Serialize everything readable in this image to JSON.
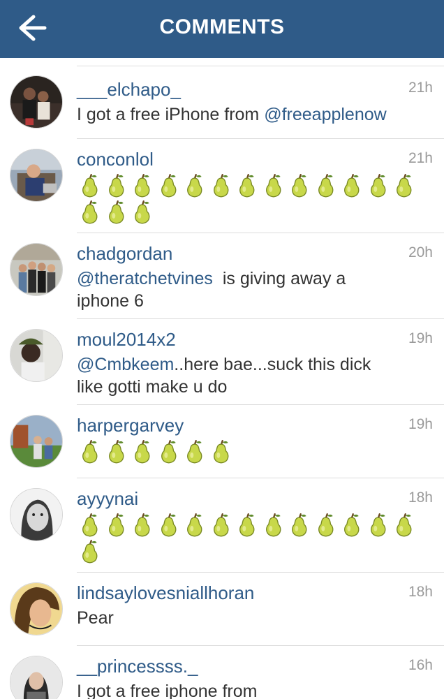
{
  "header": {
    "title": "COMMENTS"
  },
  "comments": [
    {
      "username": "___elchapo_",
      "time": "21h",
      "text": "I got a free iPhone from ",
      "mention": "@freeapplenow"
    },
    {
      "username": "conconlol",
      "time": "21h",
      "pear_count": 16
    },
    {
      "username": "chadgordan",
      "time": "20h",
      "mention": "@theratchetvines",
      "text": "  is giving away a",
      "text2": "iphone 6"
    },
    {
      "username": "moul2014x2",
      "time": "19h",
      "mention": "@Cmbkeem",
      "text": "..here bae...suck this dick",
      "text2": "like gotti make u do"
    },
    {
      "username": "harpergarvey",
      "time": "19h",
      "pear_count": 6
    },
    {
      "username": "ayyynai",
      "time": "18h",
      "pear_count": 14
    },
    {
      "username": "lindsaylovesniallhoran",
      "time": "18h",
      "text": "Pear"
    },
    {
      "username": "__princessss._",
      "time": "16h",
      "text": "I got a free iphone from"
    }
  ],
  "colors": {
    "header": "#2f5b88",
    "link": "#2f5b88",
    "text": "#333333",
    "time": "#9a9a9a",
    "pear": "#c8d84a"
  },
  "icons": {
    "back": "arrow-left-icon",
    "pear": "pear-emoji-icon"
  }
}
